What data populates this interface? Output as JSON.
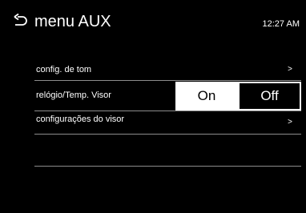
{
  "header": {
    "title": "menu AUX",
    "clock": "12:27 AM",
    "back_icon": "return-arrow-icon"
  },
  "menu": {
    "items": [
      {
        "label": "config. de tom",
        "chevron": ">"
      },
      {
        "label": "relógio/Temp. Visor",
        "toggle": {
          "on_label": "On",
          "off_label": "Off",
          "selected": "Off"
        }
      },
      {
        "label": "configurações do visor",
        "chevron": ">"
      },
      {
        "label": ""
      }
    ]
  },
  "colors": {
    "background": "#000000",
    "text": "#ffffff",
    "divider": "#8c8c8c"
  }
}
